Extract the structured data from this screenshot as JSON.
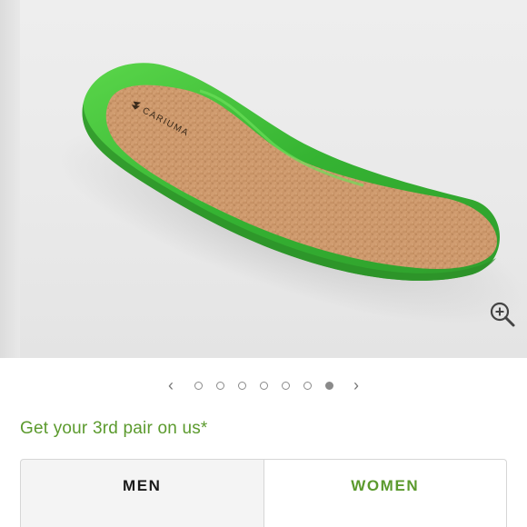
{
  "gallery": {
    "product_image_alt": "insole-image",
    "brand_mark": "CARIUMA",
    "zoom_icon": "zoom-in-icon",
    "prev_label": "‹",
    "next_label": "›",
    "total_slides": 7,
    "active_slide": 7
  },
  "promo": {
    "text": "Get your 3rd pair on us*"
  },
  "tabs": [
    {
      "label": "MEN",
      "selected": true
    },
    {
      "label": "WOMEN",
      "selected": false
    }
  ],
  "colors": {
    "accent_green": "#5b9a2d",
    "insole_green": "#3bbf3a",
    "cork": "#c99468"
  }
}
